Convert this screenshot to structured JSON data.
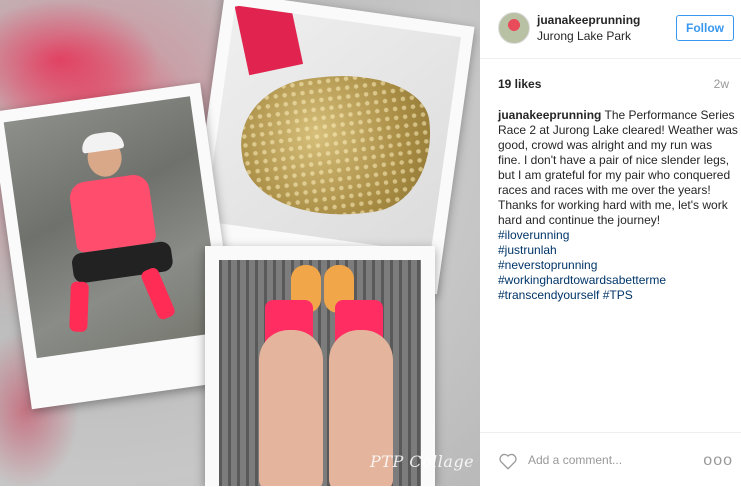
{
  "photo": {
    "watermark": "PTP Collage"
  },
  "header": {
    "username": "juanakeeprunning",
    "location": "Jurong Lake Park",
    "follow_label": "Follow"
  },
  "stats": {
    "likes": "19 likes",
    "time": "2w"
  },
  "caption": {
    "username": "juanakeeprunning",
    "text": "The Performance Series Race 2 at Jurong Lake cleared! Weather was good, crowd was alright and my run was fine. I don't have a pair of nice slender legs, but I am grateful for my pair who conquered races and races with me over the years! Thanks for working hard with me, let's work hard and continue the journey!",
    "hashtags": [
      "#iloverunning",
      "#justrunlah",
      "#neverstoprunning",
      "#workinghardtowardsabetterme"
    ],
    "last_line_tag1": "#transcendyourself",
    "last_line_tag2": "#TPS"
  },
  "footer": {
    "comment_placeholder": "Add a comment...",
    "more_label": "ooo"
  },
  "colors": {
    "accent": "#3897f0",
    "hashtag": "#003569"
  },
  "icons": {
    "like": "heart-icon",
    "more": "more-options-icon"
  }
}
